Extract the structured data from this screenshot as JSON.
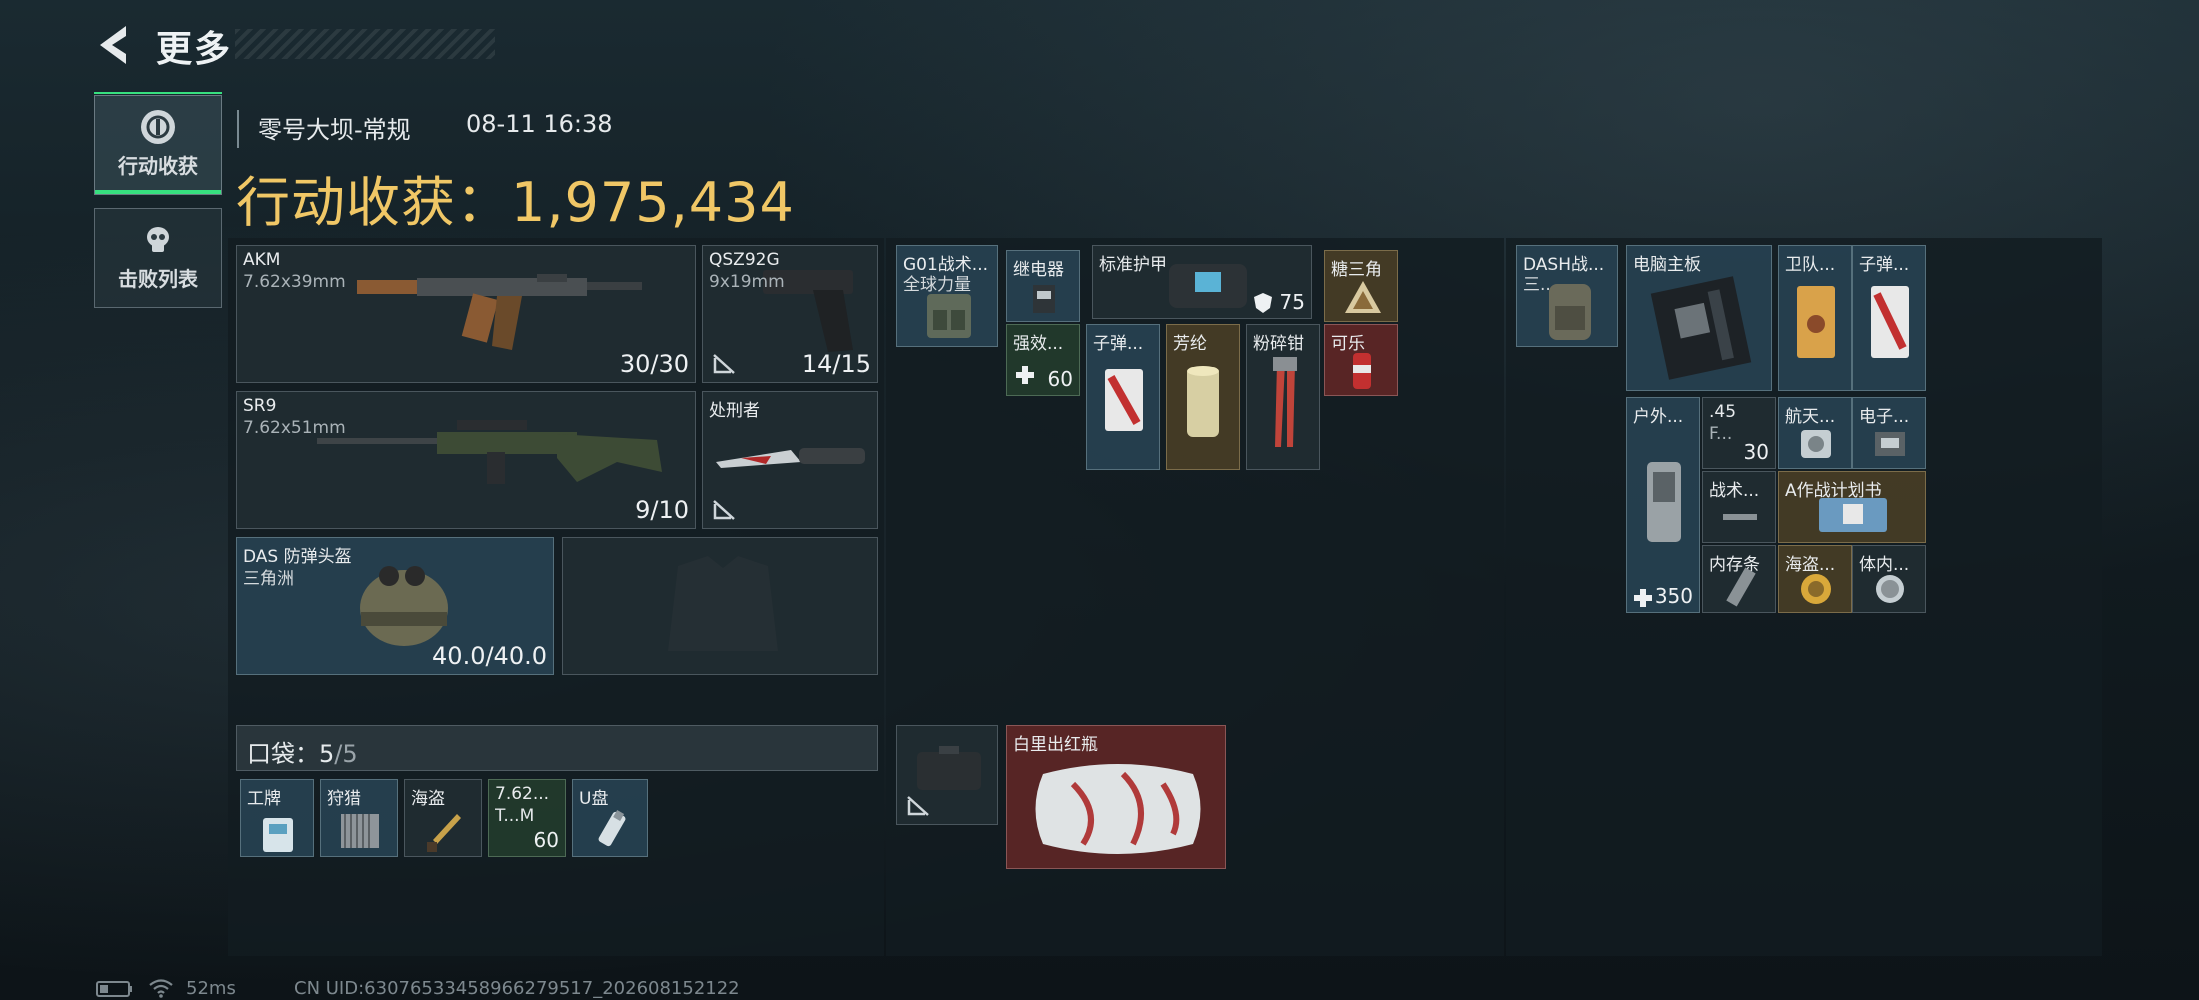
{
  "header": {
    "title": "更多"
  },
  "tabs": [
    {
      "label": "行动收获",
      "active": true,
      "icon": "operation-icon"
    },
    {
      "label": "击败列表",
      "active": false,
      "icon": "skull-icon"
    }
  ],
  "info": {
    "map": "零号大坝-常规",
    "time": "08-11 16:38",
    "earnings": "行动收获：1,975,434"
  },
  "gear": {
    "primary": {
      "name": "AKM",
      "sub": "7.62x39mm",
      "ammo": "30/30"
    },
    "sidearm": {
      "name": "QSZ92G",
      "sub": "9x19mm",
      "ammo": "14/15"
    },
    "secondary": {
      "name": "SR9",
      "sub": "7.62x51mm",
      "ammo": "9/10"
    },
    "melee": {
      "name": "处刑者"
    },
    "helmet": {
      "name": "DAS 防弹头盔",
      "sub": "三角洲",
      "durability": "40.0/40.0"
    }
  },
  "pocket": {
    "label": "口袋：",
    "count": "5",
    "total": "/5",
    "items": [
      {
        "name": "工牌"
      },
      {
        "name": "狩猎"
      },
      {
        "name": "海盗"
      },
      {
        "name": "7.62...",
        "sub": "T...M",
        "count": "60"
      },
      {
        "name": "U盘"
      }
    ]
  },
  "chest": {
    "items": [
      {
        "name": "G01战术...",
        "sub": "全球力量"
      },
      {
        "name": "继电器"
      },
      {
        "name": "标准护甲",
        "count": "75"
      },
      {
        "name": "糖三角"
      },
      {
        "name": "强效...",
        "count": "60"
      },
      {
        "name": "可乐"
      },
      {
        "name": "子弹..."
      },
      {
        "name": "芳纶"
      },
      {
        "name": "粉碎钳"
      },
      {
        "name": ""
      },
      {
        "name": "白里出红瓶"
      }
    ]
  },
  "backpack": {
    "items": [
      {
        "name": "DASH战...",
        "sub": "三..."
      },
      {
        "name": "电脑主板"
      },
      {
        "name": "卫队..."
      },
      {
        "name": "子弹..."
      },
      {
        "name": "户外...",
        "count": "350"
      },
      {
        "name": ".45",
        "sub": "F...",
        "count": "30"
      },
      {
        "name": "航天..."
      },
      {
        "name": "电子..."
      },
      {
        "name": "战术..."
      },
      {
        "name": "A作战计划书"
      },
      {
        "name": "内存条"
      },
      {
        "name": "海盗..."
      },
      {
        "name": "体内..."
      }
    ]
  },
  "footer": {
    "ping": "52ms",
    "uid": "CN UID:63076533458966279517_202608152122"
  }
}
